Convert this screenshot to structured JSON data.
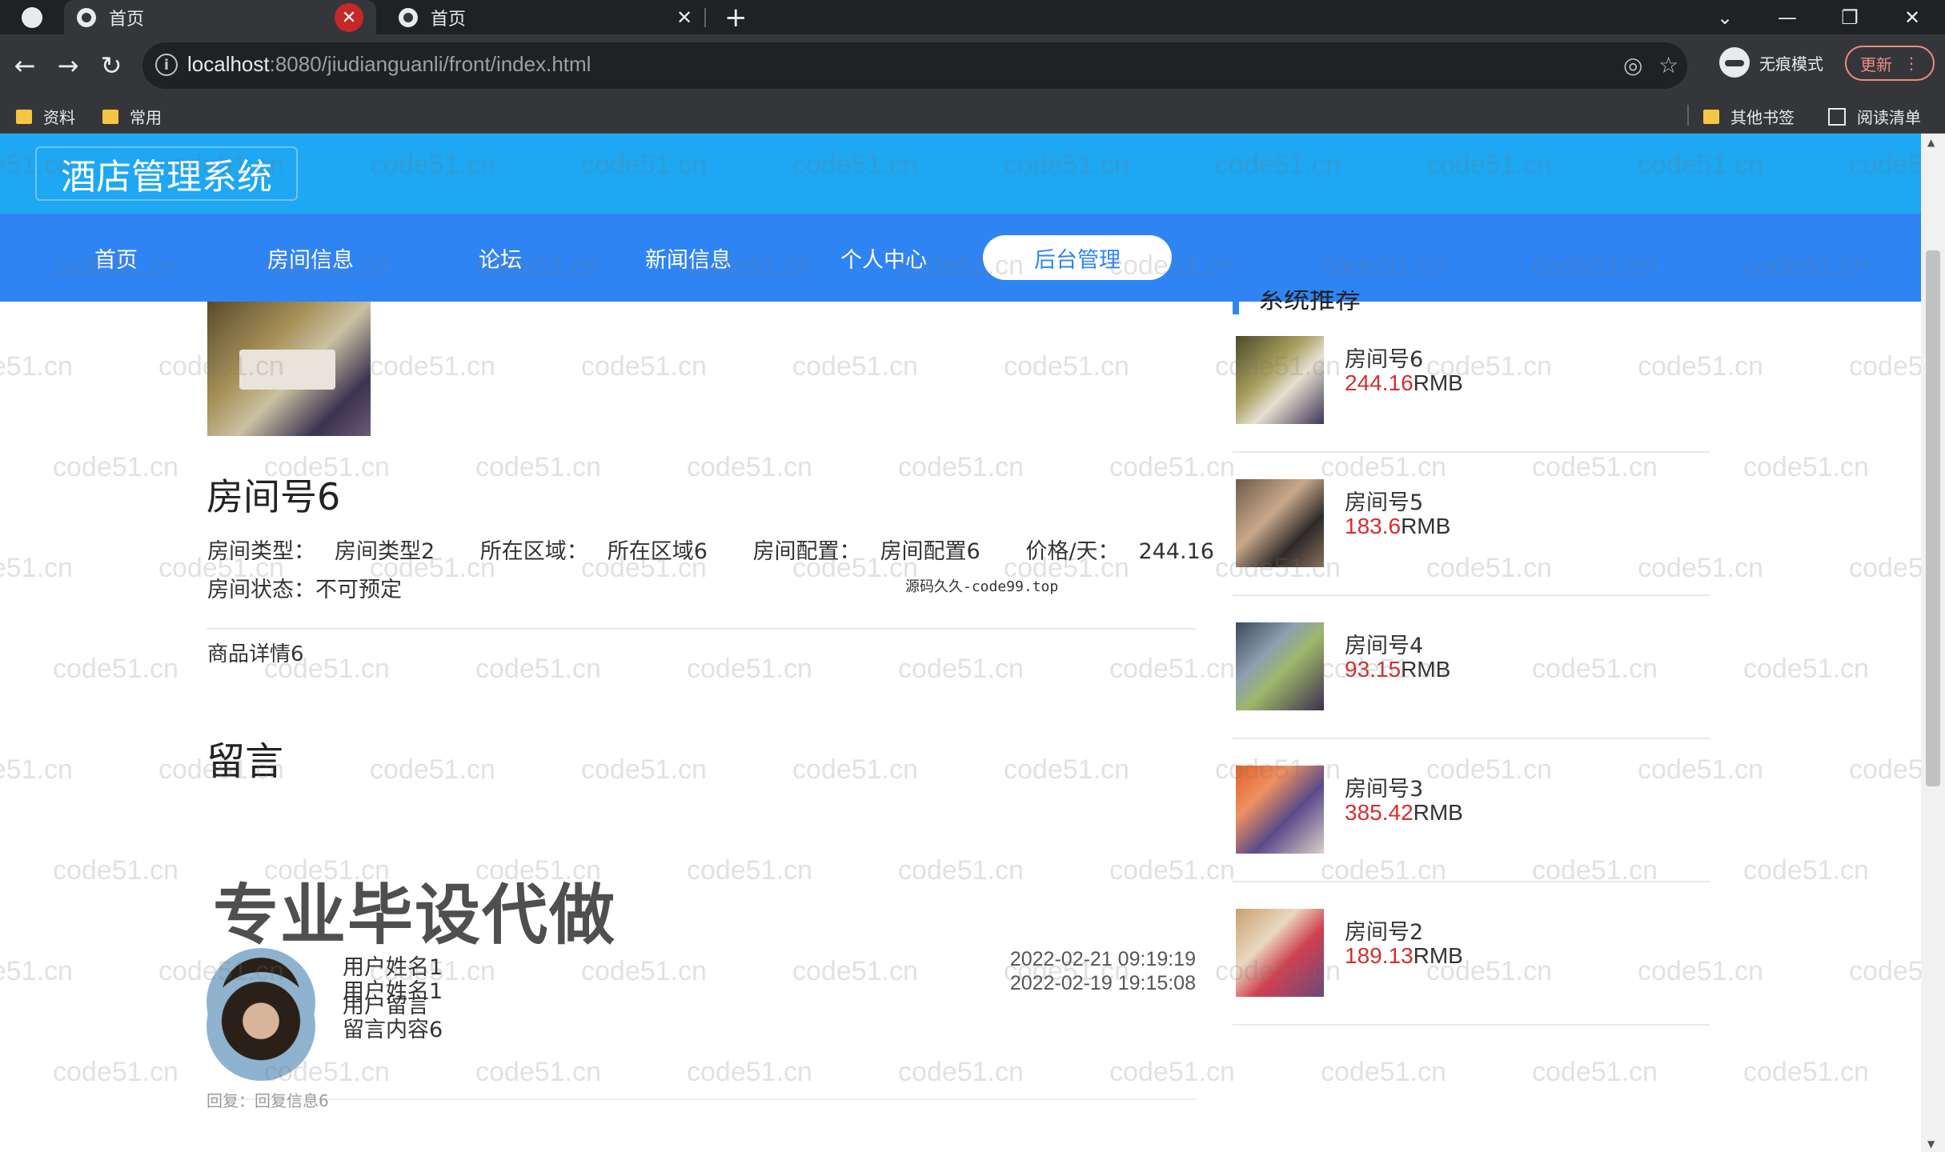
{
  "browser": {
    "tabs": [
      {
        "title": "首页",
        "active": true
      },
      {
        "title": "首页",
        "active": false
      }
    ],
    "url_host": "localhost",
    "url_path": ":8080/jiudianguanli/front/index.html",
    "incognito_label": "无痕模式",
    "update_label": "更新",
    "bookmarks": [
      {
        "label": "资料"
      },
      {
        "label": "常用"
      }
    ],
    "other_bookmarks": "其他书签",
    "reading_list": "阅读清单"
  },
  "site": {
    "logo": "酒店管理系统",
    "nav": [
      {
        "label": "首页"
      },
      {
        "label": "房间信息"
      },
      {
        "label": "论坛"
      },
      {
        "label": "新闻信息"
      },
      {
        "label": "个人中心"
      },
      {
        "label": "后台管理"
      }
    ]
  },
  "room": {
    "title": "房间号6",
    "type_label": "房间类型：",
    "type_value": "房间类型2",
    "area_label": "所在区域：",
    "area_value": "所在区域6",
    "config_label": "房间配置：",
    "config_value": "房间配置6",
    "price_label": "价格/天：",
    "price_value": "244.16",
    "status_label": "房间状态：",
    "status_value": "不可预定",
    "detail": "商品详情6",
    "small_watermark": "源码久久-code99.top"
  },
  "comments": {
    "title": "留言",
    "items": [
      {
        "user": "用户姓名1",
        "message": "用户留言",
        "date": "2022-02-21 09:19:19"
      },
      {
        "user": "用户姓名1",
        "message": "留言内容6",
        "date": "2022-02-19 19:15:08",
        "reply": "回复：回复信息6"
      }
    ]
  },
  "overlay_text": "专业毕设代做",
  "sidebar": {
    "title": "系统推荐",
    "items": [
      {
        "name": "房间号6",
        "price": "244.16",
        "unit": "RMB"
      },
      {
        "name": "房间号5",
        "price": "183.6",
        "unit": "RMB"
      },
      {
        "name": "房间号4",
        "price": "93.15",
        "unit": "RMB"
      },
      {
        "name": "房间号3",
        "price": "385.42",
        "unit": "RMB"
      },
      {
        "name": "房间号2",
        "price": "189.13",
        "unit": "RMB"
      }
    ]
  },
  "watermark": "code51.cn",
  "colors": {
    "header": "#1ea7f2",
    "nav": "#2f84f4",
    "price": "#d32f2f"
  }
}
